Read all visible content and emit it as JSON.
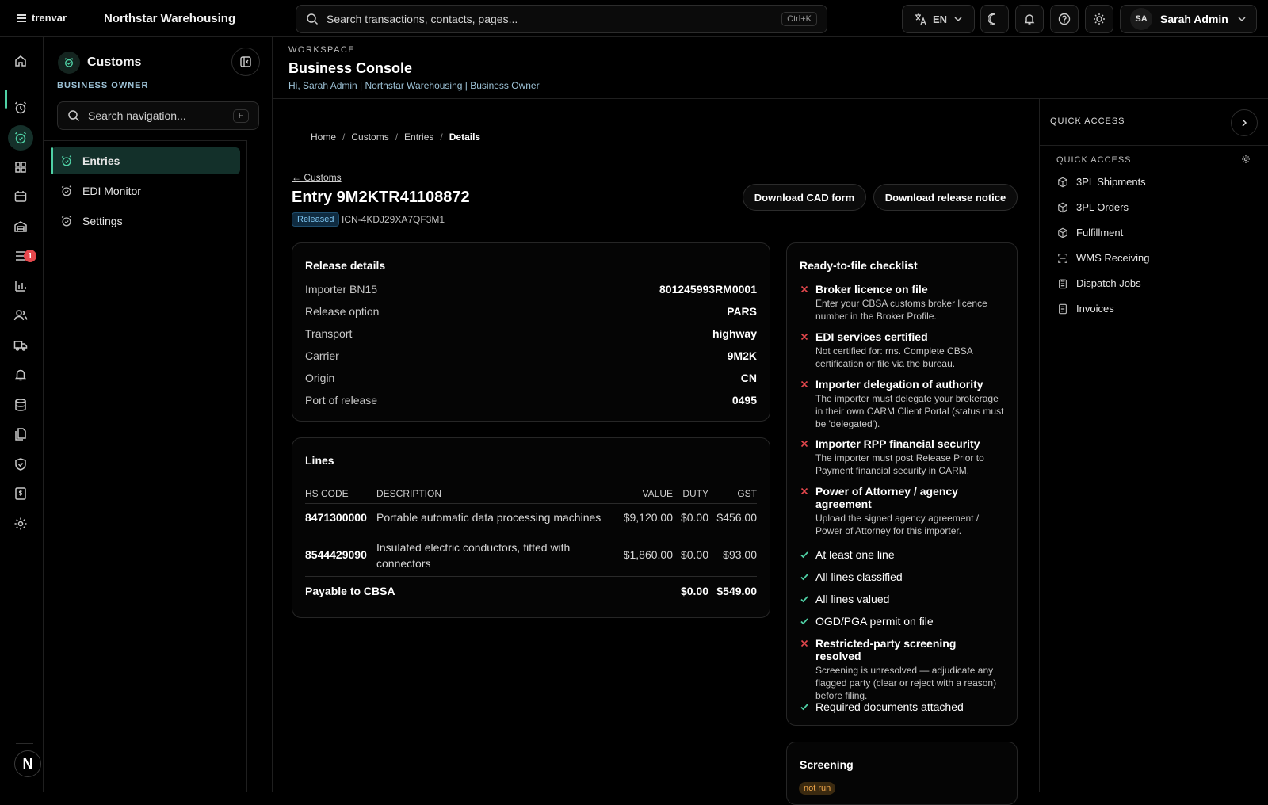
{
  "topbar": {
    "logo_text": "trenvar",
    "org_name": "Northstar Warehousing",
    "search_placeholder": "Search transactions, contacts, pages...",
    "search_shortcut": "Ctrl+K",
    "language": "EN",
    "user_initials": "SA",
    "user_name": "Sarah Admin"
  },
  "rail": {
    "notification_badge": "1"
  },
  "sidebar": {
    "title": "Customs",
    "role": "BUSINESS OWNER",
    "search_placeholder": "Search navigation...",
    "search_shortcut": "F",
    "items": [
      {
        "label": "Entries",
        "active": true
      },
      {
        "label": "EDI Monitor"
      },
      {
        "label": "Settings"
      }
    ]
  },
  "header": {
    "eyebrow": "WORKSPACE",
    "title": "Business Console",
    "subtitle": "Hi, Sarah Admin | Northstar Warehousing | Business Owner"
  },
  "breadcrumb": [
    "Home",
    "Customs",
    "Entries",
    "Details"
  ],
  "entry": {
    "back_link": "← Customs",
    "title": "Entry 9M2KTR41108872",
    "status": "Released",
    "icn": "ICN-4KDJ29XA7QF3M1",
    "actions": [
      "Download CAD form",
      "Download release notice"
    ]
  },
  "release_details": {
    "title": "Release details",
    "rows": [
      {
        "label": "Importer BN15",
        "value": "801245993RM0001"
      },
      {
        "label": "Release option",
        "value": "PARS"
      },
      {
        "label": "Transport",
        "value": "highway"
      },
      {
        "label": "Carrier",
        "value": "9M2K"
      },
      {
        "label": "Origin",
        "value": "CN"
      },
      {
        "label": "Port of release",
        "value": "0495"
      }
    ]
  },
  "lines": {
    "title": "Lines",
    "columns": [
      "HS CODE",
      "DESCRIPTION",
      "VALUE",
      "DUTY",
      "GST"
    ],
    "rows": [
      {
        "hs": "8471300000",
        "desc": "Portable automatic data processing machines",
        "value": "$9,120.00",
        "duty": "$0.00",
        "gst": "$456.00"
      },
      {
        "hs": "8544429090",
        "desc": "Insulated electric conductors, fitted with connectors",
        "value": "$1,860.00",
        "duty": "$0.00",
        "gst": "$93.00"
      }
    ],
    "total_label": "Payable to CBSA",
    "total_duty": "$0.00",
    "total_gst": "$549.00"
  },
  "checklist": {
    "title": "Ready-to-file checklist",
    "items": [
      {
        "ok": false,
        "label": "Broker licence on file",
        "detail": "Enter your CBSA customs broker licence number in the Broker Profile."
      },
      {
        "ok": false,
        "label": "EDI services certified",
        "detail": "Not certified for: rns. Complete CBSA certification or file via the bureau."
      },
      {
        "ok": false,
        "label": "Importer delegation of authority",
        "detail": "The importer must delegate your brokerage in their own CARM Client Portal (status must be 'delegated')."
      },
      {
        "ok": false,
        "label": "Importer RPP financial security",
        "detail": "The importer must post Release Prior to Payment financial security in CARM."
      },
      {
        "ok": false,
        "label": "Power of Attorney / agency agreement",
        "detail": "Upload the signed agency agreement / Power of Attorney for this importer."
      },
      {
        "ok": true,
        "label": "At least one line"
      },
      {
        "ok": true,
        "label": "All lines classified"
      },
      {
        "ok": true,
        "label": "All lines valued"
      },
      {
        "ok": true,
        "label": "OGD/PGA permit on file"
      },
      {
        "ok": false,
        "label": "Restricted-party screening resolved",
        "detail": "Screening is unresolved — adjudicate any flagged party (clear or reject with a reason) before filing."
      },
      {
        "ok": true,
        "label": "Required documents attached"
      }
    ]
  },
  "screening": {
    "title": "Screening",
    "status": "not run"
  },
  "quick_access": {
    "header": "QUICK ACCESS",
    "section": "QUICK ACCESS",
    "items": [
      {
        "label": "3PL Shipments",
        "icon": "box-icon"
      },
      {
        "label": "3PL Orders",
        "icon": "box-icon"
      },
      {
        "label": "Fulfillment",
        "icon": "box-icon"
      },
      {
        "label": "WMS Receiving",
        "icon": "scan-icon"
      },
      {
        "label": "Dispatch Jobs",
        "icon": "clipboard-icon"
      },
      {
        "label": "Invoices",
        "icon": "receipt-icon"
      }
    ]
  },
  "colors": {
    "accent": "#4fd1a5",
    "danger": "#e5484d",
    "info": "#7dc4f0"
  }
}
